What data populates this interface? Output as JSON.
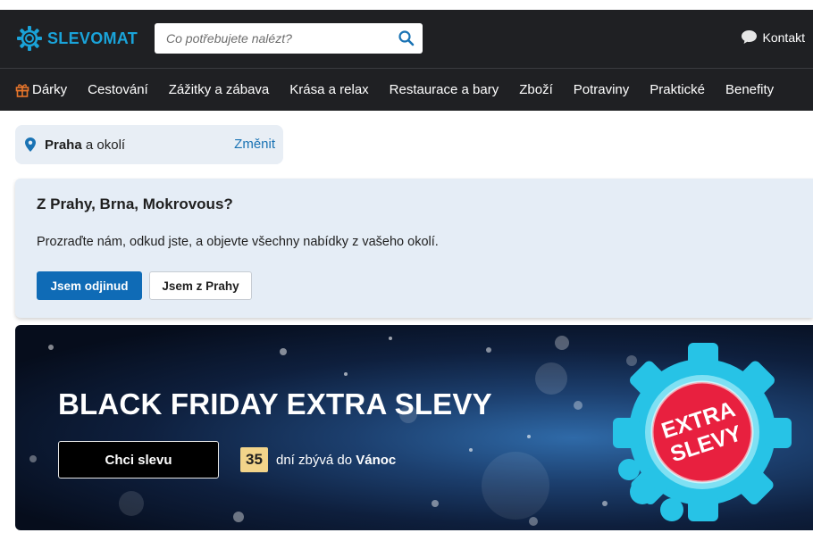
{
  "header": {
    "logo_text": "SLEVOMAT",
    "search_placeholder": "Co potřebujete nalézt?",
    "contact_label": "Kontakt"
  },
  "nav": {
    "items": [
      {
        "label": "Dárky",
        "icon": "gift-icon"
      },
      {
        "label": "Cestování"
      },
      {
        "label": "Zážitky a zábava"
      },
      {
        "label": "Krása a relax"
      },
      {
        "label": "Restaurace a bary"
      },
      {
        "label": "Zboží"
      },
      {
        "label": "Potraviny"
      },
      {
        "label": "Praktické"
      },
      {
        "label": "Benefity"
      }
    ]
  },
  "location": {
    "city": "Praha",
    "suffix": "a okolí",
    "change_label": "Změnit",
    "icon": "location-pin-icon"
  },
  "location_prompt": {
    "title": "Z Prahy, Brna, Mokrovous?",
    "text": "Prozraďte nám, odkud jste, a objevte všechny nabídky z vašeho okolí.",
    "primary_button": "Jsem odjinud",
    "secondary_button": "Jsem z Prahy"
  },
  "promo": {
    "title": "BLACK FRIDAY EXTRA SLEVY",
    "button_label": "Chci slevu",
    "countdown_number": "35",
    "countdown_text": "dní zbývá do",
    "countdown_target": "Vánoc",
    "badge_line1": "EXTRA",
    "badge_line2": "SLEVY"
  },
  "colors": {
    "header_bg": "#1f2023",
    "brand": "#1aa3d9",
    "primary": "#0f6bb6",
    "badge_red": "#e8203f",
    "gear_cyan": "#27c3e6"
  }
}
